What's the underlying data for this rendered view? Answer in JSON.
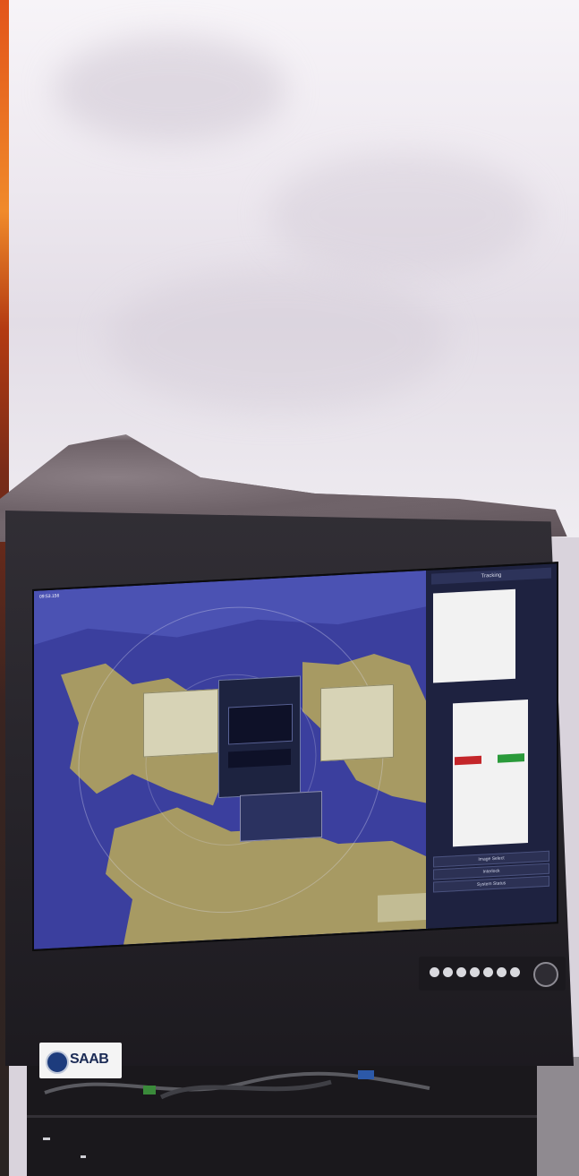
{
  "photo": {
    "description_hidden": "",
    "brand_logo": {
      "text": "SAAB"
    },
    "screen": {
      "time": "09:53.156",
      "right_panel_title": "Tracking",
      "right_panel_buttons": [
        "Image Select",
        "Interlock",
        "System Status"
      ]
    }
  },
  "colors": {
    "sea": "#3b3f9e",
    "land": "#a79a63",
    "bezel": "#26232a",
    "sky": "#ede8ef"
  },
  "icons": [
    "saab-logo-icon",
    "monitor-control-button-icon",
    "rotary-knob-icon"
  ]
}
